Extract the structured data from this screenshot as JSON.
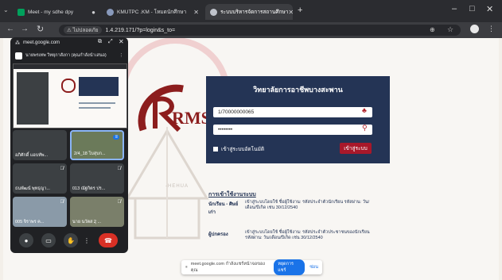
{
  "browser": {
    "tabs": [
      {
        "label": "Meet - my sdhe dpy",
        "active": false
      },
      {
        "label": "KMUTPC .KM - โหมดนักศึกษา",
        "active": false
      },
      {
        "label": "ระบบบริหารจัดการสถานศึกษา",
        "active": true
      }
    ],
    "new_tab_symbol": "+",
    "window_controls": [
      "–",
      "□",
      "✕"
    ],
    "address": {
      "security_label": "ไม่ปลอดภัย",
      "url": "1.4.219.171/?p=login&s_to="
    }
  },
  "login": {
    "title": "วิทยาลัยการอาชีพบางสะพาน",
    "username_value": "1/70000000065",
    "password_value": "••••••••",
    "remember_label": "เข้าสู่ระบบอัตโนมัติ",
    "submit_label": "เข้าสู่ระบบ"
  },
  "logo": {
    "text": "RMS",
    "sub": "-HEHUA"
  },
  "howto": {
    "title": "การเข้าใช้งานระบบ",
    "rows": [
      {
        "label": "นักเรียน - ศิษย์เก่า",
        "text": "เข้าสู่ระบบโดยใช้ ชื่อผู้ใช้งาน: รหัสประจำตัวนักเรียน รหัสผ่าน: วัน/เดือน/ปีเกิด เช่น 30/12/2540"
      },
      {
        "label": "ผู้ปกครอง",
        "text": "เข้าสู่ระบบโดยใช้ ชื่อผู้ใช้งาน: รหัสประจำตัวประชาชนของนักเรียน รหัสผ่าน: วัน/เดือน/ปีเกิด เช่น 30/12/2540"
      }
    ]
  },
  "sharebar": {
    "text": "meet.google.com กำลังแชร์หน้าจอของคุณ",
    "stop_label": "หยุดการแชร์",
    "hide_label": "ซ่อน"
  },
  "meet": {
    "domain": "meet.google.com",
    "presenting_text": "นายพรเทพ วิทยุกาสังกา (คุณกำลังนำเสนอ)",
    "tiles": [
      {
        "name": "อภิศักดิ์ แอบทัพ...",
        "muted": false
      },
      {
        "name": "2/4_18 โบสุบก...",
        "muted": false
      },
      {
        "name": "ธนพัฒน์ พุทธุญา...",
        "muted": true
      },
      {
        "name": "013 ณัฐกิตร ปร...",
        "muted": true
      },
      {
        "name": "005 จิราพร ค...",
        "muted": true
      },
      {
        "name": "นาย นวัตส 2ุ ...",
        "muted": true
      }
    ]
  },
  "colors": {
    "navy": "#243455",
    "crimson": "#a8182a",
    "meet_bg": "#202124"
  }
}
